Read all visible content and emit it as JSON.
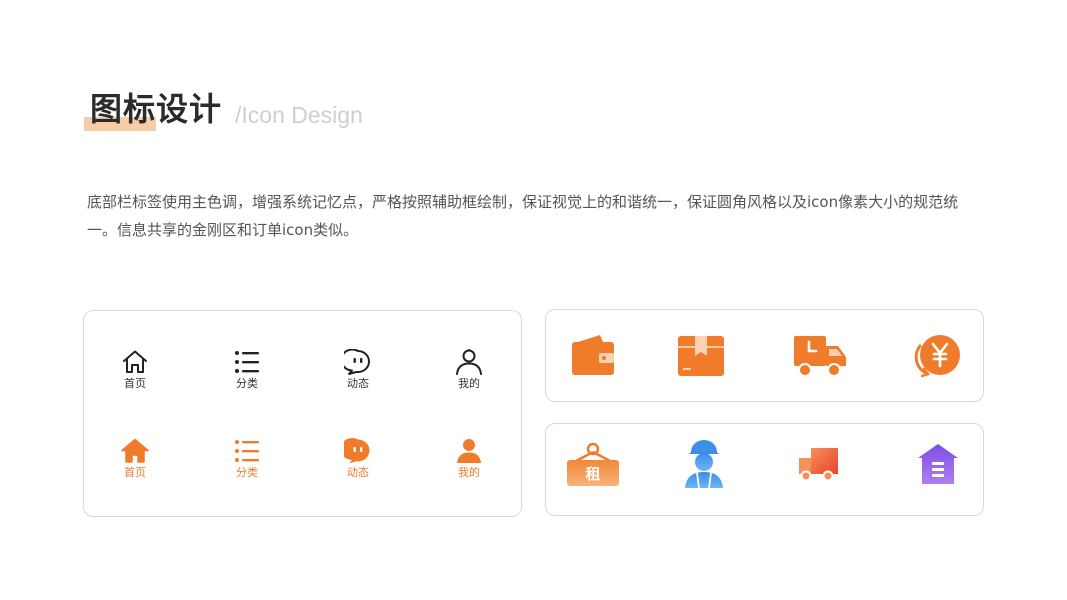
{
  "header": {
    "title": "图标设计",
    "subtitle": "/Icon Design"
  },
  "description": "底部栏标签使用主色调，增强系统记忆点，严格按照辅助框绘制，保证视觉上的和谐统一，保证圆角风格以及icon像素大小的规范统一。信息共享的金刚区和订单icon类似。",
  "colors": {
    "accent": "#ef7b2b",
    "outline": "#222222",
    "blue": "#3b8fe8",
    "purple": "#8b4fe6"
  },
  "tabbar_outline": [
    {
      "icon": "home-icon",
      "label": "首页"
    },
    {
      "icon": "list-icon",
      "label": "分类"
    },
    {
      "icon": "chat-icon",
      "label": "动态"
    },
    {
      "icon": "user-icon",
      "label": "我的"
    }
  ],
  "tabbar_filled": [
    {
      "icon": "home-icon",
      "label": "首页"
    },
    {
      "icon": "list-icon",
      "label": "分类"
    },
    {
      "icon": "chat-icon",
      "label": "动态"
    },
    {
      "icon": "user-icon",
      "label": "我的"
    }
  ],
  "order_icons": [
    "wallet-icon",
    "package-icon",
    "delivery-truck-icon",
    "refund-icon"
  ],
  "feature_icons": [
    {
      "icon": "rent-sign-icon",
      "text": "租"
    },
    {
      "icon": "worker-icon"
    },
    {
      "icon": "truck-icon"
    },
    {
      "icon": "warehouse-icon"
    }
  ]
}
